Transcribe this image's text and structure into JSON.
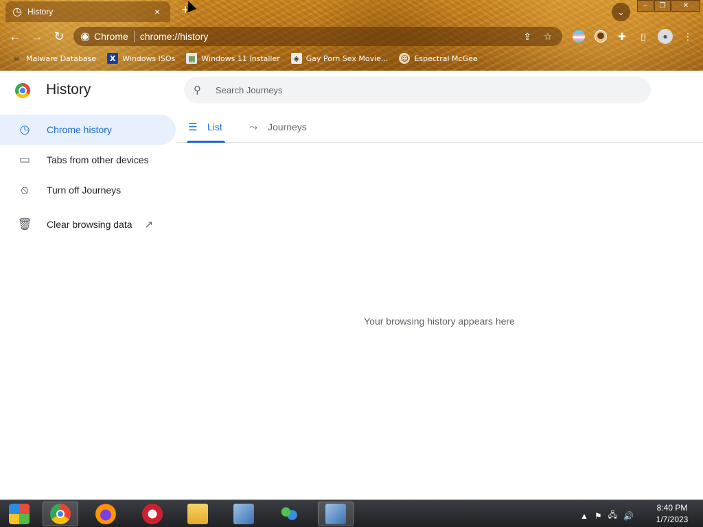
{
  "browser": {
    "tab": {
      "title": "History",
      "icon": "history-icon",
      "close": "×"
    },
    "new_tab": "+",
    "window_controls": {
      "minimize": "–",
      "maximize": "❐",
      "close": "✕"
    },
    "toolbar": {
      "back": "←",
      "forward": "→",
      "reload": "↻",
      "site_chip": "Chrome",
      "url": "chrome://history"
    },
    "bookmarks": [
      {
        "label": "Malware Database",
        "icon": "☠"
      },
      {
        "label": "Windows ISOs",
        "icon": "X"
      },
      {
        "label": "Windows 11 Installer",
        "icon": "▦"
      },
      {
        "label": "Gay Porn Sex Movie...",
        "icon": "◈"
      },
      {
        "label": "Espectral McGee",
        "icon": "☺"
      }
    ]
  },
  "history_page": {
    "title": "History",
    "search": {
      "placeholder": "Search Journeys"
    },
    "sidebar": [
      {
        "label": "Chrome history",
        "icon": "clock-icon",
        "glyph": "◷",
        "active": true
      },
      {
        "label": "Tabs from other devices",
        "icon": "devices-icon",
        "glyph": "▭"
      },
      {
        "label": "Turn off Journeys",
        "icon": "journeys-off-icon",
        "glyph": "⦸"
      },
      {
        "label": "Clear browsing data",
        "icon": "trash-icon",
        "glyph": "🗑",
        "external_glyph": "↗"
      }
    ],
    "tabs": [
      {
        "label": "List",
        "glyph": "☰",
        "active": true
      },
      {
        "label": "Journeys",
        "glyph": "⤳"
      }
    ],
    "empty_message": "Your browsing history appears here"
  },
  "taskbar": {
    "clock_time": "8:40 PM",
    "clock_date": "1/7/2023",
    "tray": {
      "chevron": "▲",
      "flag": "⚑",
      "network": "🖧",
      "volume": "🔊"
    }
  },
  "colors": {
    "accent": "#1967d2",
    "active_bg": "#e8f0fe",
    "search_bg": "#f1f3f4",
    "text": "#202124",
    "secondary_text": "#5f6368"
  }
}
